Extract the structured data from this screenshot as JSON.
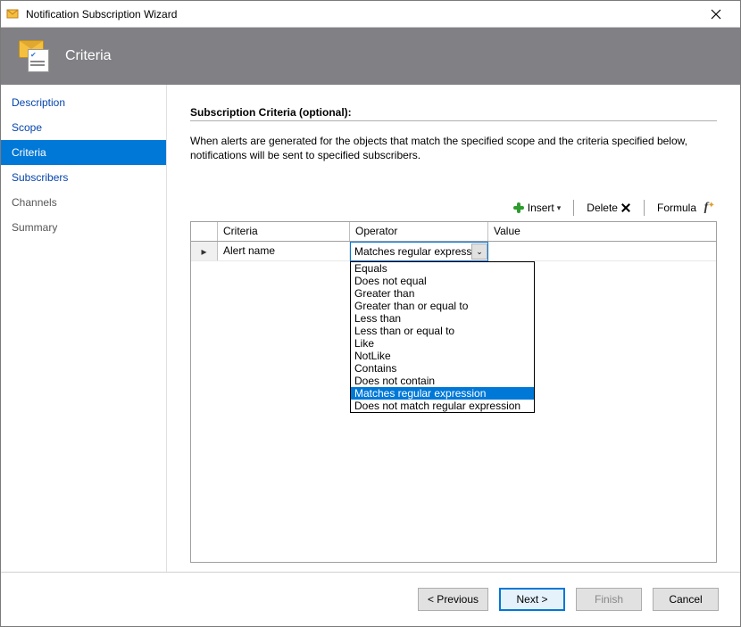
{
  "window": {
    "title": "Notification Subscription Wizard",
    "banner_title": "Criteria"
  },
  "sidebar": {
    "items": [
      {
        "label": "Description",
        "active": false,
        "disabled": false
      },
      {
        "label": "Scope",
        "active": false,
        "disabled": false
      },
      {
        "label": "Criteria",
        "active": true,
        "disabled": false
      },
      {
        "label": "Subscribers",
        "active": false,
        "disabled": false
      },
      {
        "label": "Channels",
        "active": false,
        "disabled": true
      },
      {
        "label": "Summary",
        "active": false,
        "disabled": true
      }
    ]
  },
  "main": {
    "heading": "Subscription Criteria (optional):",
    "description": "When alerts are generated for the objects that match the specified scope and the criteria specified below, notifications will be sent to specified subscribers.",
    "toolbar": {
      "insert_label": "Insert",
      "delete_label": "Delete",
      "formula_label": "Formula"
    },
    "grid": {
      "headers": {
        "criteria": "Criteria",
        "operator": "Operator",
        "value": "Value"
      },
      "rows": [
        {
          "criteria": "Alert name",
          "operator_display": "Matches regular expression",
          "value": ""
        }
      ]
    },
    "dropdown": {
      "options": [
        "Equals",
        "Does not equal",
        "Greater than",
        "Greater than or equal to",
        "Less than",
        "Less than or equal to",
        "Like",
        "NotLike",
        "Contains",
        "Does not contain",
        "Matches regular expression",
        "Does not match regular expression"
      ],
      "selected_index": 10
    }
  },
  "footer": {
    "previous": "< Previous",
    "next": "Next >",
    "finish": "Finish",
    "cancel": "Cancel"
  }
}
